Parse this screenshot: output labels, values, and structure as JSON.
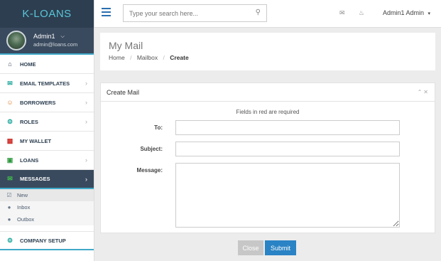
{
  "brand": "K-LOANS",
  "profile": {
    "name": "Admin1",
    "email": "admin@loans.com"
  },
  "nav": [
    {
      "label": "HOME",
      "icon": "home-icon",
      "color": "#2c3e50"
    },
    {
      "label": "EMAIL TEMPLATES",
      "icon": "envelope-icon",
      "color": "#1aa59a"
    },
    {
      "label": "BORROWERS",
      "icon": "smiley-icon",
      "color": "#e07a2a"
    },
    {
      "label": "ROLES",
      "icon": "cogs-icon",
      "color": "#1aa59a"
    },
    {
      "label": "MY WALLET",
      "icon": "briefcase-icon",
      "color": "#d0312d"
    },
    {
      "label": "LOANS",
      "icon": "money-icon",
      "color": "#2e9a3e"
    },
    {
      "label": "MESSAGES",
      "icon": "envelope-icon",
      "color": "#2e9a3e"
    },
    {
      "label": "COMPANY SETUP",
      "icon": "cogs-icon",
      "color": "#1aa59a"
    }
  ],
  "submenu": [
    {
      "label": "New",
      "icon": "check-square-icon"
    },
    {
      "label": "Inbox",
      "icon": "bullet-icon"
    },
    {
      "label": "Outbox",
      "icon": "bullet-icon"
    }
  ],
  "topbar": {
    "search_placeholder": "Type your search here...",
    "user": "Admin1 Admin"
  },
  "page": {
    "title": "My Mail",
    "breadcrumb": [
      "Home",
      "Mailbox",
      "Create"
    ]
  },
  "form": {
    "panel_title": "Create Mail",
    "required_note": "Fields in red are required",
    "to_label": "To:",
    "subject_label": "Subject:",
    "message_label": "Message:",
    "to_value": "",
    "subject_value": "",
    "message_value": "",
    "close_label": "Close",
    "submit_label": "Submit"
  }
}
